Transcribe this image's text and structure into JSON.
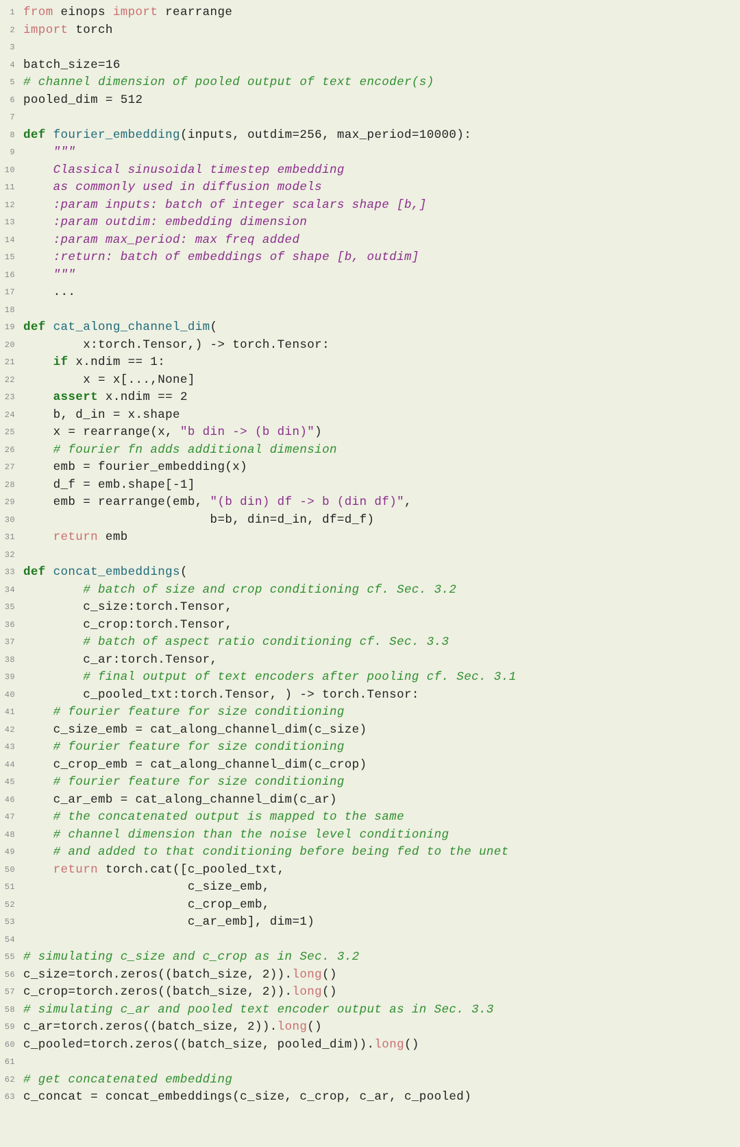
{
  "lines": [
    [
      {
        "t": "from ",
        "c": "kwr"
      },
      {
        "t": "einops ",
        "c": "id"
      },
      {
        "t": "import ",
        "c": "kwr"
      },
      {
        "t": "rearrange",
        "c": "id"
      }
    ],
    [
      {
        "t": "import ",
        "c": "kwr"
      },
      {
        "t": "torch",
        "c": "id"
      }
    ],
    [
      {
        "t": "",
        "c": "id"
      }
    ],
    [
      {
        "t": "batch_size=16",
        "c": "id"
      }
    ],
    [
      {
        "t": "# channel dimension of pooled output of text encoder(s)",
        "c": "cm"
      }
    ],
    [
      {
        "t": "pooled_dim = 512",
        "c": "id"
      }
    ],
    [
      {
        "t": "",
        "c": "id"
      }
    ],
    [
      {
        "t": "def ",
        "c": "kw"
      },
      {
        "t": "fourier_embedding",
        "c": "fn"
      },
      {
        "t": "(inputs, outdim=256, max_period=10000):",
        "c": "id"
      }
    ],
    [
      {
        "t": "    \"\"\"",
        "c": "doc"
      }
    ],
    [
      {
        "t": "    Classical sinusoidal timestep embedding",
        "c": "doc"
      }
    ],
    [
      {
        "t": "    as commonly used in diffusion models",
        "c": "doc"
      }
    ],
    [
      {
        "t": "    :param inputs: batch of integer scalars shape [b,]",
        "c": "doc"
      }
    ],
    [
      {
        "t": "    :param outdim: embedding dimension",
        "c": "doc"
      }
    ],
    [
      {
        "t": "    :param max_period: max freq added",
        "c": "doc"
      }
    ],
    [
      {
        "t": "    :return: batch of embeddings of shape [b, outdim]",
        "c": "doc"
      }
    ],
    [
      {
        "t": "    \"\"\"",
        "c": "doc"
      }
    ],
    [
      {
        "t": "    ...",
        "c": "id"
      }
    ],
    [
      {
        "t": "",
        "c": "id"
      }
    ],
    [
      {
        "t": "def ",
        "c": "kw"
      },
      {
        "t": "cat_along_channel_dim",
        "c": "fn"
      },
      {
        "t": "(",
        "c": "id"
      }
    ],
    [
      {
        "t": "        x:torch.Tensor,) -> torch.Tensor:",
        "c": "id"
      }
    ],
    [
      {
        "t": "    if ",
        "c": "kw"
      },
      {
        "t": "x.ndim == 1:",
        "c": "id"
      }
    ],
    [
      {
        "t": "        x = x[...,None]",
        "c": "id"
      }
    ],
    [
      {
        "t": "    assert ",
        "c": "kw"
      },
      {
        "t": "x.ndim == 2",
        "c": "id"
      }
    ],
    [
      {
        "t": "    b, d_in = x.shape",
        "c": "id"
      }
    ],
    [
      {
        "t": "    x = rearrange(x, ",
        "c": "id"
      },
      {
        "t": "\"b din -> (b din)\"",
        "c": "st"
      },
      {
        "t": ")",
        "c": "id"
      }
    ],
    [
      {
        "t": "    # fourier fn adds additional dimension",
        "c": "cm"
      }
    ],
    [
      {
        "t": "    emb = fourier_embedding(x)",
        "c": "id"
      }
    ],
    [
      {
        "t": "    d_f = emb.shape[-1]",
        "c": "id"
      }
    ],
    [
      {
        "t": "    emb = rearrange(emb, ",
        "c": "id"
      },
      {
        "t": "\"(b din) df -> b (din df)\"",
        "c": "st"
      },
      {
        "t": ",",
        "c": "id"
      }
    ],
    [
      {
        "t": "                         b=b, din=d_in, df=d_f)",
        "c": "id"
      }
    ],
    [
      {
        "t": "    return ",
        "c": "kwr"
      },
      {
        "t": "emb",
        "c": "id"
      }
    ],
    [
      {
        "t": "",
        "c": "id"
      }
    ],
    [
      {
        "t": "def ",
        "c": "kw"
      },
      {
        "t": "concat_embeddings",
        "c": "fn"
      },
      {
        "t": "(",
        "c": "id"
      }
    ],
    [
      {
        "t": "        # batch of size and crop conditioning cf. Sec. 3.2",
        "c": "cm"
      }
    ],
    [
      {
        "t": "        c_size:torch.Tensor,",
        "c": "id"
      }
    ],
    [
      {
        "t": "        c_crop:torch.Tensor,",
        "c": "id"
      }
    ],
    [
      {
        "t": "        # batch of aspect ratio conditioning cf. Sec. 3.3",
        "c": "cm"
      }
    ],
    [
      {
        "t": "        c_ar:torch.Tensor,",
        "c": "id"
      }
    ],
    [
      {
        "t": "        # final output of text encoders after pooling cf. Sec. 3.1",
        "c": "cm"
      }
    ],
    [
      {
        "t": "        c_pooled_txt:torch.Tensor, ) -> torch.Tensor:",
        "c": "id"
      }
    ],
    [
      {
        "t": "    # fourier feature for size conditioning",
        "c": "cm"
      }
    ],
    [
      {
        "t": "    c_size_emb = cat_along_channel_dim(c_size)",
        "c": "id"
      }
    ],
    [
      {
        "t": "    # fourier feature for size conditioning",
        "c": "cm"
      }
    ],
    [
      {
        "t": "    c_crop_emb = cat_along_channel_dim(c_crop)",
        "c": "id"
      }
    ],
    [
      {
        "t": "    # fourier feature for size conditioning",
        "c": "cm"
      }
    ],
    [
      {
        "t": "    c_ar_emb = cat_along_channel_dim(c_ar)",
        "c": "id"
      }
    ],
    [
      {
        "t": "    # the concatenated output is mapped to the same",
        "c": "cm"
      }
    ],
    [
      {
        "t": "    # channel dimension than the noise level conditioning",
        "c": "cm"
      }
    ],
    [
      {
        "t": "    # and added to that conditioning before being fed to the unet",
        "c": "cm"
      }
    ],
    [
      {
        "t": "    return ",
        "c": "kwr"
      },
      {
        "t": "torch.cat([c_pooled_txt,",
        "c": "id"
      }
    ],
    [
      {
        "t": "                      c_size_emb,",
        "c": "id"
      }
    ],
    [
      {
        "t": "                      c_crop_emb,",
        "c": "id"
      }
    ],
    [
      {
        "t": "                      c_ar_emb], dim=1)",
        "c": "id"
      }
    ],
    [
      {
        "t": "",
        "c": "id"
      }
    ],
    [
      {
        "t": "# simulating c_size and c_crop as in Sec. 3.2",
        "c": "cm"
      }
    ],
    [
      {
        "t": "c_size=torch.zeros((batch_size, 2)).",
        "c": "id"
      },
      {
        "t": "long",
        "c": "long"
      },
      {
        "t": "()",
        "c": "id"
      }
    ],
    [
      {
        "t": "c_crop=torch.zeros((batch_size, 2)).",
        "c": "id"
      },
      {
        "t": "long",
        "c": "long"
      },
      {
        "t": "()",
        "c": "id"
      }
    ],
    [
      {
        "t": "# simulating c_ar and pooled text encoder output as in Sec. 3.3",
        "c": "cm"
      }
    ],
    [
      {
        "t": "c_ar=torch.zeros((batch_size, 2)).",
        "c": "id"
      },
      {
        "t": "long",
        "c": "long"
      },
      {
        "t": "()",
        "c": "id"
      }
    ],
    [
      {
        "t": "c_pooled=torch.zeros((batch_size, pooled_dim)).",
        "c": "id"
      },
      {
        "t": "long",
        "c": "long"
      },
      {
        "t": "()",
        "c": "id"
      }
    ],
    [
      {
        "t": "",
        "c": "id"
      }
    ],
    [
      {
        "t": "# get concatenated embedding",
        "c": "cm"
      }
    ],
    [
      {
        "t": "c_concat = concat_embeddings(c_size, c_crop, c_ar, c_pooled)",
        "c": "id"
      }
    ]
  ]
}
